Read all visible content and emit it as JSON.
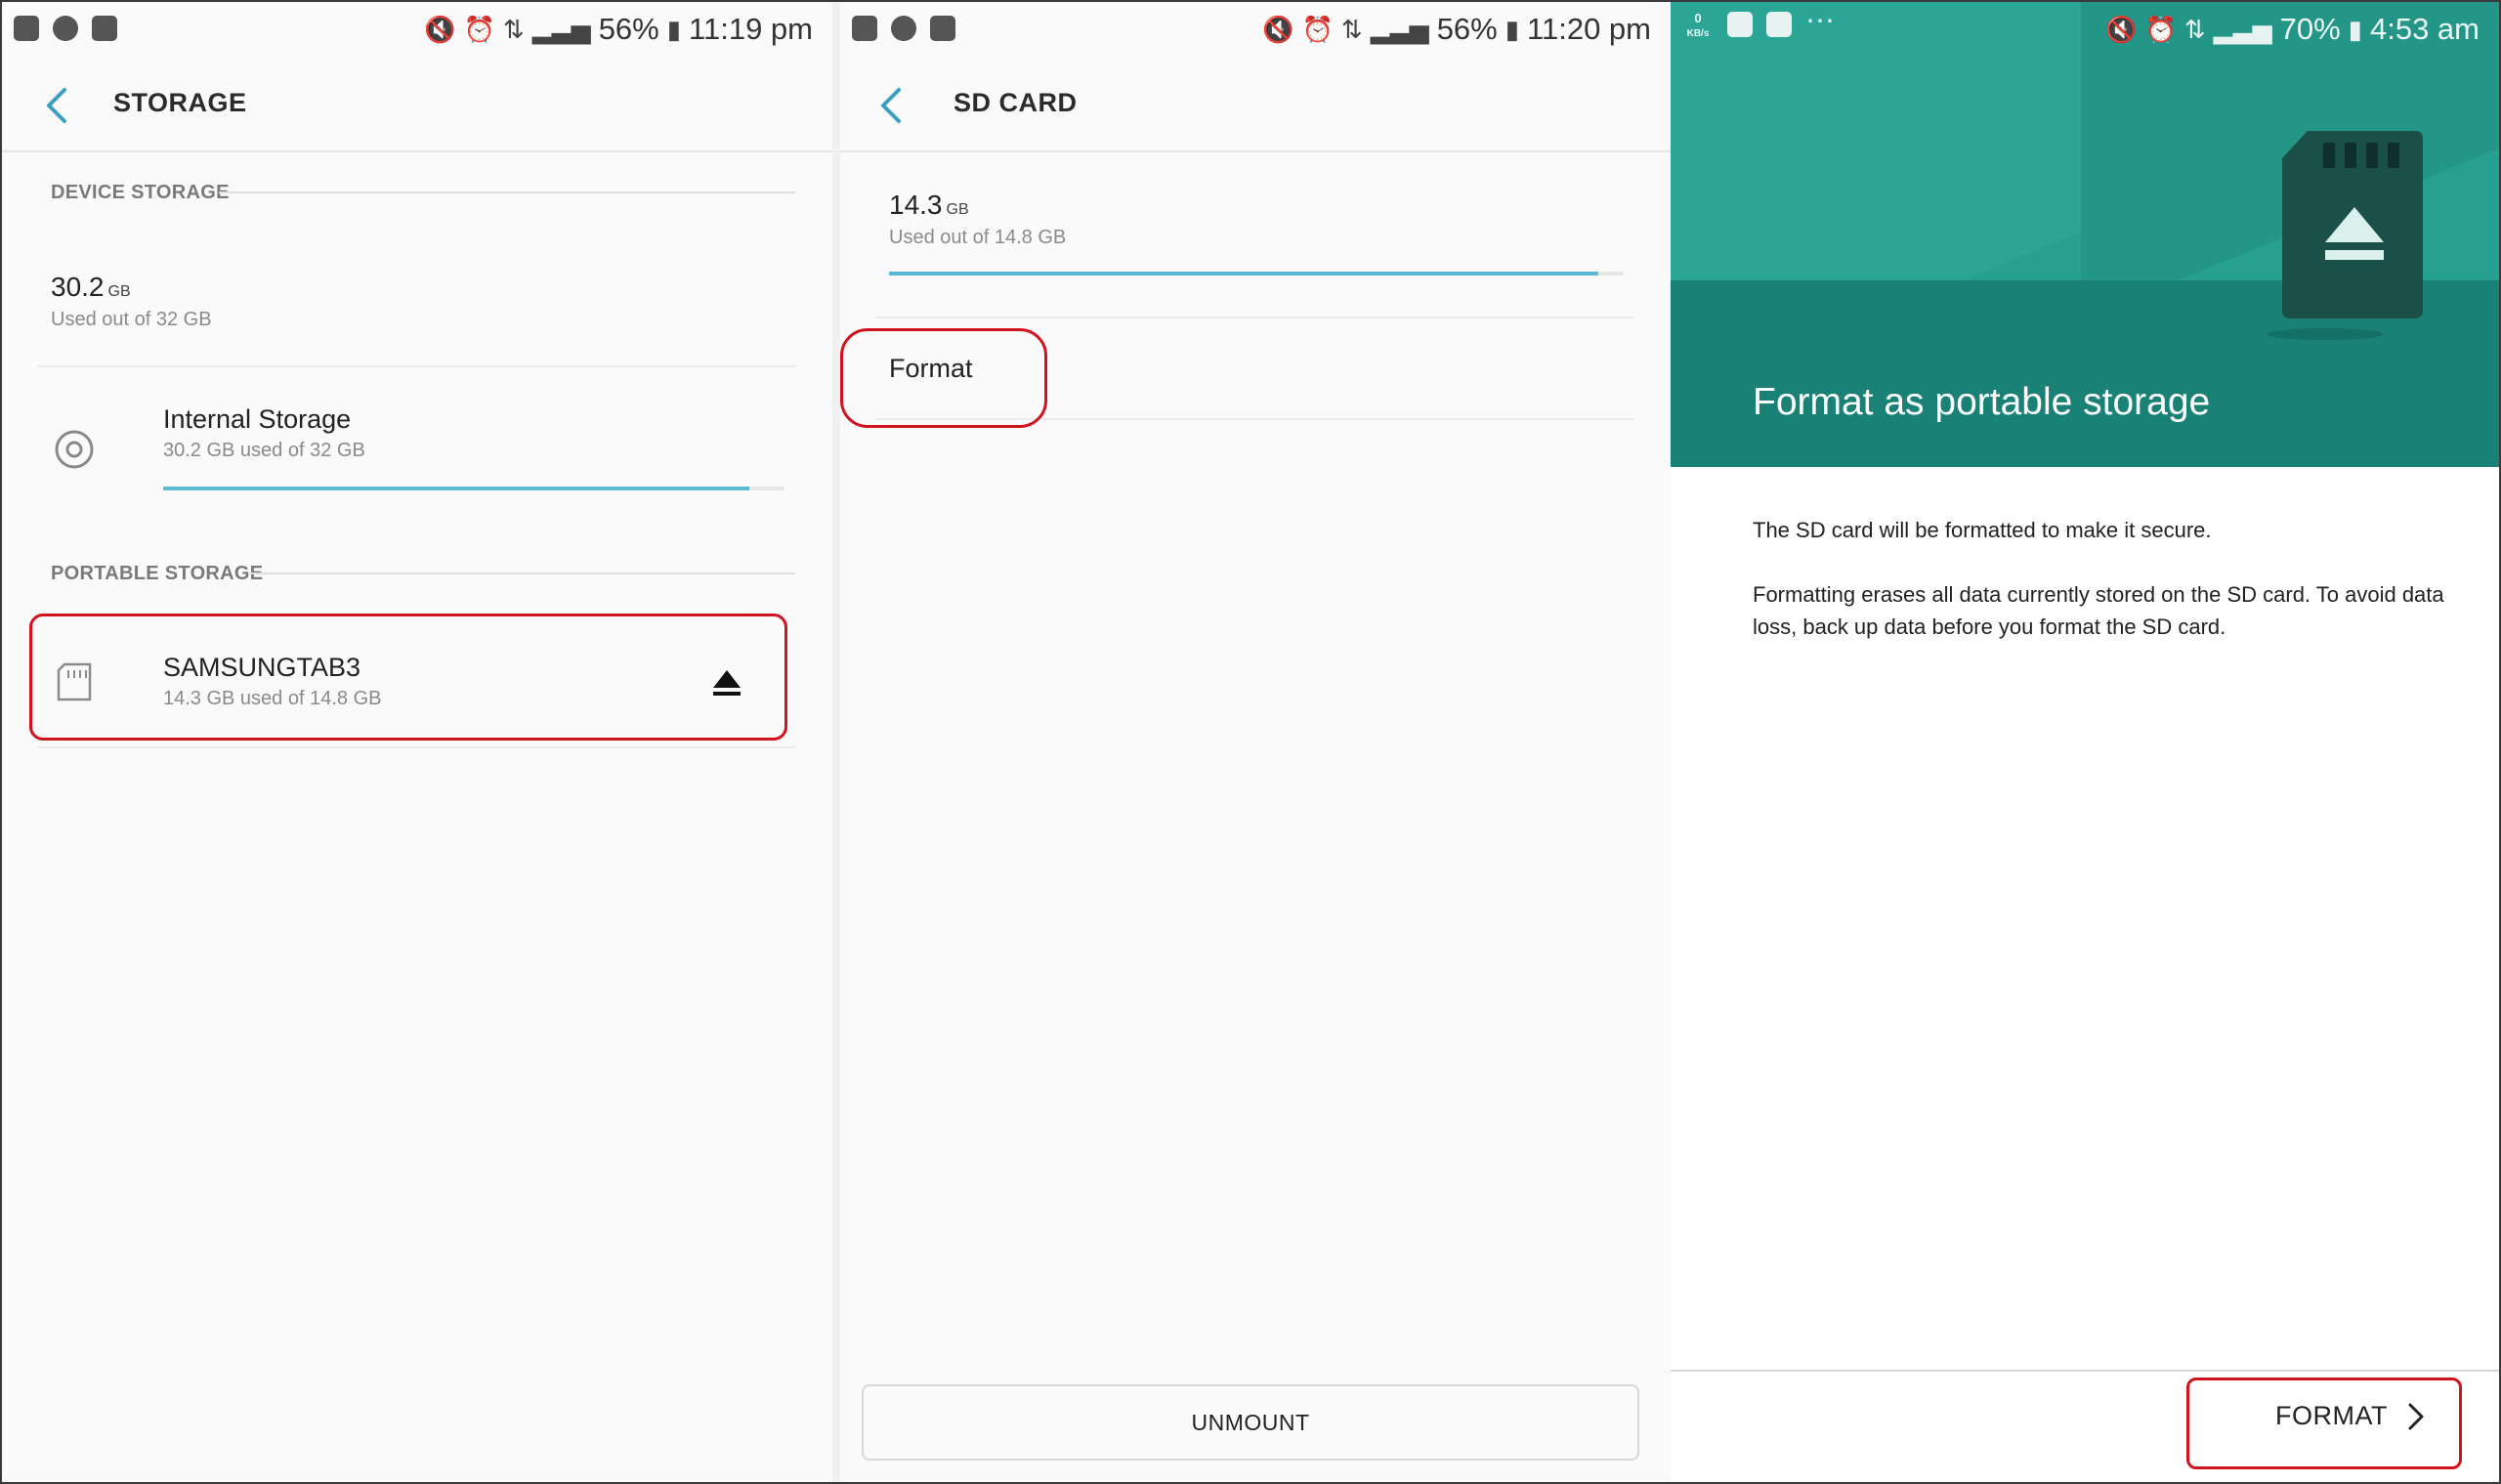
{
  "colors": {
    "accent": "#5bbbd3",
    "teal": "#22948a",
    "highlight": "#d0131f",
    "text": "#222222",
    "subtext": "#8a8a8a"
  },
  "panels": [
    {
      "status": {
        "battery": "56%",
        "time": "11:19 pm"
      },
      "header": {
        "title": "STORAGE"
      },
      "device_storage": {
        "section_label": "DEVICE STORAGE",
        "used_value": "30.2",
        "used_unit": "GB",
        "used_caption": "Used out of 32 GB",
        "item": {
          "title": "Internal Storage",
          "subtitle": "30.2 GB used of 32 GB",
          "icon": "storage-ring-icon",
          "usage_fraction": 0.944
        }
      },
      "portable_storage": {
        "section_label": "PORTABLE STORAGE",
        "item": {
          "title": "SAMSUNGTAB3",
          "subtitle": "14.3 GB used of 14.8 GB",
          "icon": "sd-card-icon",
          "action_icon": "eject-icon"
        }
      }
    },
    {
      "status": {
        "battery": "56%",
        "time": "11:20 pm"
      },
      "header": {
        "title": "SD CARD"
      },
      "used_value": "14.3",
      "used_unit": "GB",
      "used_caption": "Used out of 14.8 GB",
      "usage_fraction": 0.966,
      "format_label": "Format",
      "unmount_label": "UNMOUNT"
    },
    {
      "status": {
        "netspeed_value": "0",
        "netspeed_unit": "KB/s",
        "battery": "70%",
        "time": "4:53 am"
      },
      "hero_title": "Format as portable storage",
      "hero_icon": "sd-card-eject-icon",
      "body": [
        "The SD card will be formatted to make it secure.",
        "Formatting erases all data currently stored on the SD card. To avoid data loss, back up data before you format the SD card."
      ],
      "format_button_label": "FORMAT"
    }
  ]
}
